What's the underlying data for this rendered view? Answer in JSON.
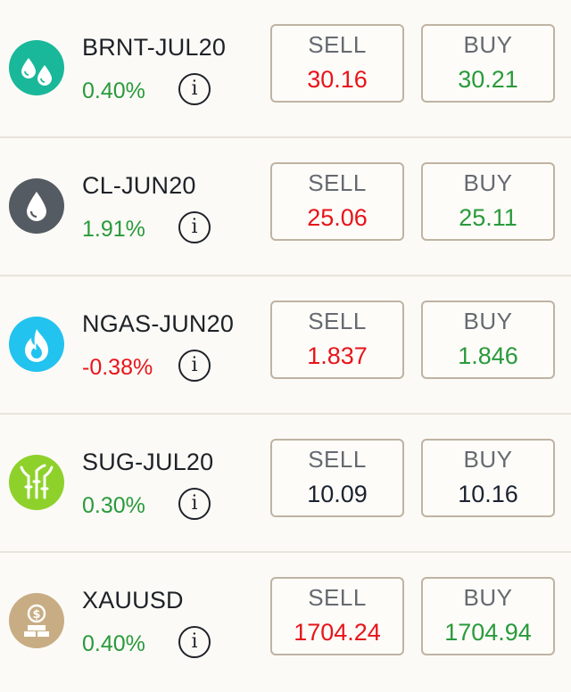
{
  "instruments": [
    {
      "symbol": "BRNT-JUL20",
      "change": "0.40%",
      "change_color": "#2a9a3b",
      "icon": "water-drops-icon",
      "icon_bg": "#19b89a",
      "sell_label": "SELL",
      "sell_price": "30.16",
      "sell_color": "#e8141a",
      "buy_label": "BUY",
      "buy_price": "30.21",
      "buy_color": "#2a9a3b"
    },
    {
      "symbol": "CL-JUN20",
      "change": "1.91%",
      "change_color": "#2a9a3b",
      "icon": "oil-drop-icon",
      "icon_bg": "#555b62",
      "sell_label": "SELL",
      "sell_price": "25.06",
      "sell_color": "#e8141a",
      "buy_label": "BUY",
      "buy_price": "25.11",
      "buy_color": "#2a9a3b"
    },
    {
      "symbol": "NGAS-JUN20",
      "change": "-0.38%",
      "change_color": "#e8141a",
      "icon": "flame-icon",
      "icon_bg": "#22c3ee",
      "sell_label": "SELL",
      "sell_price": "1.837",
      "sell_color": "#e8141a",
      "buy_label": "BUY",
      "buy_price": "1.846",
      "buy_color": "#2a9a3b"
    },
    {
      "symbol": "SUG-JUL20",
      "change": "0.30%",
      "change_color": "#2a9a3b",
      "icon": "sugarcane-icon",
      "icon_bg": "#8ed12b",
      "sell_label": "SELL",
      "sell_price": "10.09",
      "sell_color": "#1b2330",
      "buy_label": "BUY",
      "buy_price": "10.16",
      "buy_color": "#1b2330"
    },
    {
      "symbol": "XAUUSD",
      "change": "0.40%",
      "change_color": "#2a9a3b",
      "icon": "gold-bars-icon",
      "icon_bg": "#c8ad84",
      "sell_label": "SELL",
      "sell_price": "1704.24",
      "sell_color": "#e8141a",
      "buy_label": "BUY",
      "buy_price": "1704.94",
      "buy_color": "#2a9a3b"
    }
  ],
  "info_glyph": "i"
}
